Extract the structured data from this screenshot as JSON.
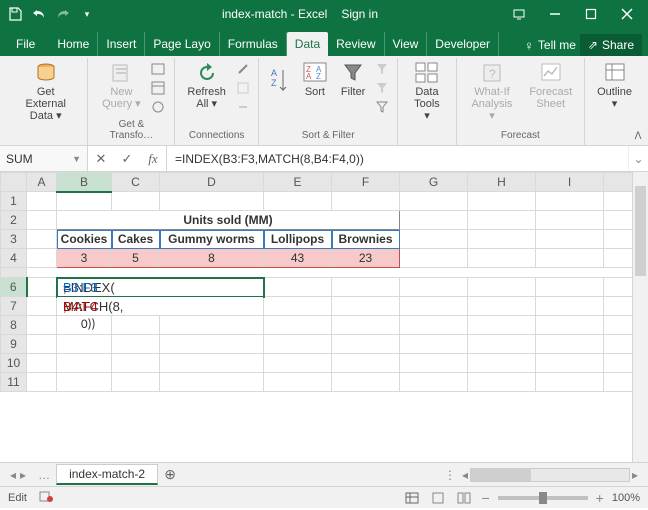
{
  "titlebar": {
    "doc_title": "index-match - Excel",
    "sign_in": "Sign in"
  },
  "tabs": {
    "file": "File",
    "home": "Home",
    "insert": "Insert",
    "pagelayout": "Page Layo",
    "formulas": "Formulas",
    "data": "Data",
    "review": "Review",
    "view": "View",
    "developer": "Developer",
    "tellme": "Tell me",
    "share": "Share"
  },
  "ribbon": {
    "get_external": "Get External\nData ▾",
    "new_query": "New\nQuery ▾",
    "refresh_all": "Refresh\nAll ▾",
    "sort": "Sort",
    "filter": "Filter",
    "data_tools": "Data\nTools ▾",
    "whatif": "What-If\nAnalysis ▾",
    "forecast_sheet": "Forecast\nSheet",
    "outline": "Outline\n▾",
    "group_get_transform": "Get & Transfo…",
    "group_connections": "Connections",
    "group_sort_filter": "Sort & Filter",
    "group_forecast": "Forecast"
  },
  "formula_bar": {
    "name_box": "SUM",
    "formula": "=INDEX(B3:F3,MATCH(8,B4:F4,0))"
  },
  "columns": [
    "A",
    "B",
    "C",
    "D",
    "E",
    "F",
    "G",
    "H",
    "I"
  ],
  "rows": [
    "1",
    "2",
    "3",
    "4",
    "",
    "6",
    "7",
    "8",
    "9",
    "10",
    "11"
  ],
  "data": {
    "title": "Units sold (MM)",
    "headers": [
      "Cookies",
      "Cakes",
      "Gummy worms",
      "Lollipops",
      "Brownies"
    ],
    "values": [
      "3",
      "5",
      "8",
      "43",
      "23"
    ],
    "f6": "=INDEX(",
    "f6_ref": "B3:F3",
    "f6_end": ",",
    "f7": "MATCH(8,",
    "f7_ref": "B4:F4",
    "f7_end": ",",
    "f8": "0))"
  },
  "sheet_tabs": {
    "ellipsis": "…",
    "active": "index-match-2"
  },
  "status": {
    "mode": "Edit",
    "zoom": "100%"
  },
  "chart_data": {
    "type": "table",
    "title": "Units sold (MM)",
    "categories": [
      "Cookies",
      "Cakes",
      "Gummy worms",
      "Lollipops",
      "Brownies"
    ],
    "values": [
      3,
      5,
      8,
      43,
      23
    ]
  }
}
